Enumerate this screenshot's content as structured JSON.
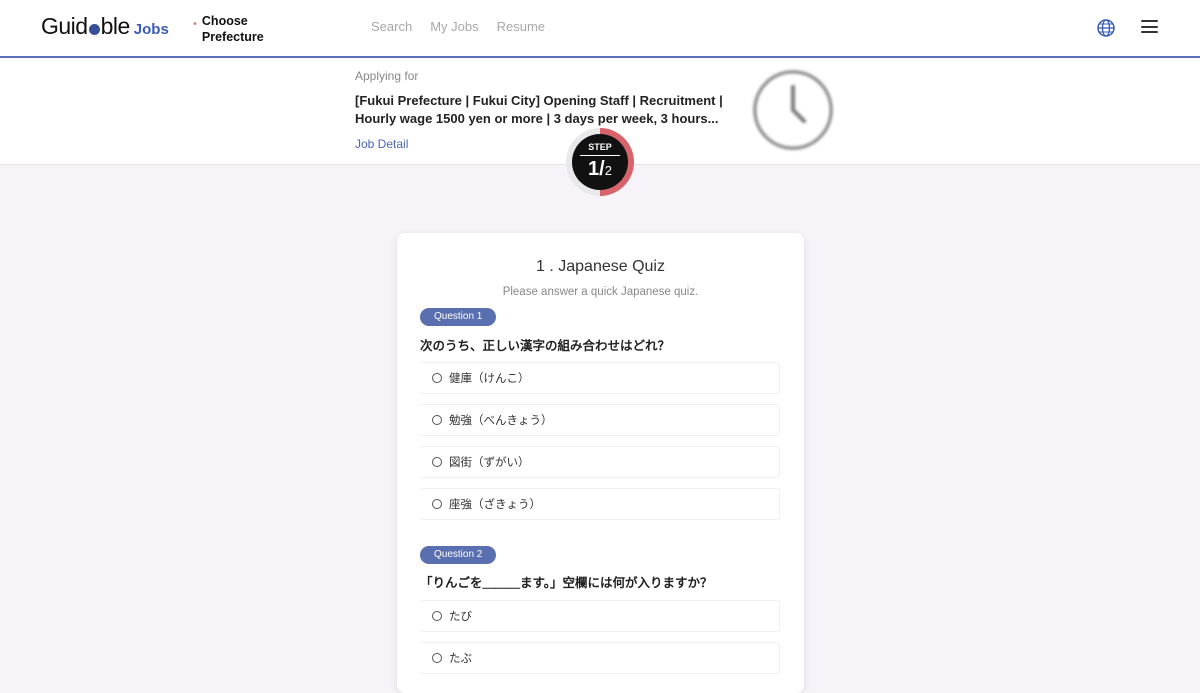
{
  "header": {
    "logo_main": "Guid",
    "logo_main_rest": "ble",
    "logo_jobs": "Jobs",
    "prefecture_label": "Choose Prefecture",
    "nav": [
      "Search",
      "My Jobs",
      "Resume"
    ],
    "icons": {
      "language": "globe-icon",
      "menu": "hamburger-menu-icon"
    },
    "accent_color": "#5a6fb8"
  },
  "banner": {
    "applying_for": "Applying for",
    "job_title": "[Fukui Prefecture | Fukui City] Opening Staff | Recruitment | Hourly wage 1500 yen or more | 3 days per week, 3 hours...",
    "job_detail_link": "Job Detail"
  },
  "step": {
    "label": "STEP",
    "current": "1/",
    "total": "2",
    "progress": 0.5,
    "progress_color": "#d9636b"
  },
  "quiz": {
    "title": "1 . Japanese Quiz",
    "subtitle": "Please answer a quick Japanese quiz.",
    "questions": [
      {
        "badge": "Question 1",
        "text": "次のうち、正しい漢字の組み合わせはどれ？",
        "options": [
          "健庫（けんこ）",
          "勉強（べんきょう）",
          "図街（ずがい）",
          "座強（ざきょう）"
        ]
      },
      {
        "badge": "Question 2",
        "text": "「りんごを＿＿＿ます。」空欄には何が入りますか？",
        "options": [
          "たび",
          "たぶ"
        ]
      }
    ]
  }
}
